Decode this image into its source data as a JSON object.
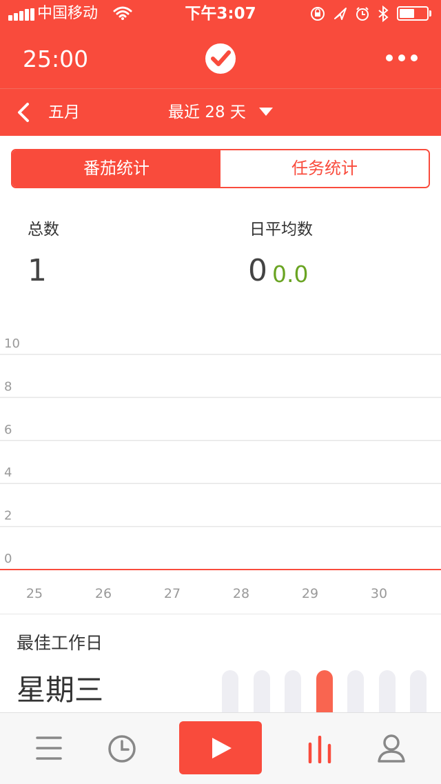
{
  "status_bar": {
    "carrier": "中国移动",
    "time": "下午3:07",
    "icons": [
      "signal-icon",
      "wifi-icon",
      "lock-rotation-icon",
      "location-icon",
      "alarm-icon",
      "bluetooth-icon",
      "battery-icon"
    ],
    "battery_level": 0.55
  },
  "header": {
    "timer": "25:00",
    "logo_icon": "check-circle-icon",
    "menu_icon": "more-icon"
  },
  "period_bar": {
    "back_label": "五月",
    "range_label": "最近 28 天"
  },
  "segment": {
    "tabs": [
      {
        "label": "番茄统计",
        "active": true
      },
      {
        "label": "任务统计",
        "active": false
      }
    ]
  },
  "stats": {
    "total_label": "总数",
    "total_value": "1",
    "daily_avg_label": "日平均数",
    "daily_avg_value": "0",
    "daily_avg_decimal": "0.0"
  },
  "chart_data": {
    "type": "bar",
    "categories": [
      "25",
      "26",
      "27",
      "28",
      "29",
      "30"
    ],
    "values": [
      0,
      0,
      0,
      0,
      0,
      0
    ],
    "y_ticks": [
      "10",
      "8",
      "6",
      "4",
      "2",
      "0"
    ],
    "ylim": [
      0,
      10
    ],
    "grid": true,
    "baseline_color": "#f94b3c"
  },
  "best_day": {
    "label": "最佳工作日",
    "value": "星期三",
    "bars": [
      0,
      0,
      1,
      1,
      0,
      0,
      0
    ],
    "highlight_index": 3
  },
  "tab_bar": {
    "items": [
      {
        "name": "list-icon",
        "active": false
      },
      {
        "name": "clock-icon",
        "active": false
      },
      {
        "name": "play-icon",
        "active": false
      },
      {
        "name": "stats-icon",
        "active": true
      },
      {
        "name": "profile-icon",
        "active": false
      }
    ]
  },
  "colors": {
    "accent": "#f94b3c",
    "positive": "#6aa423",
    "grid": "#e6e6e6",
    "tick_text": "#999999"
  }
}
